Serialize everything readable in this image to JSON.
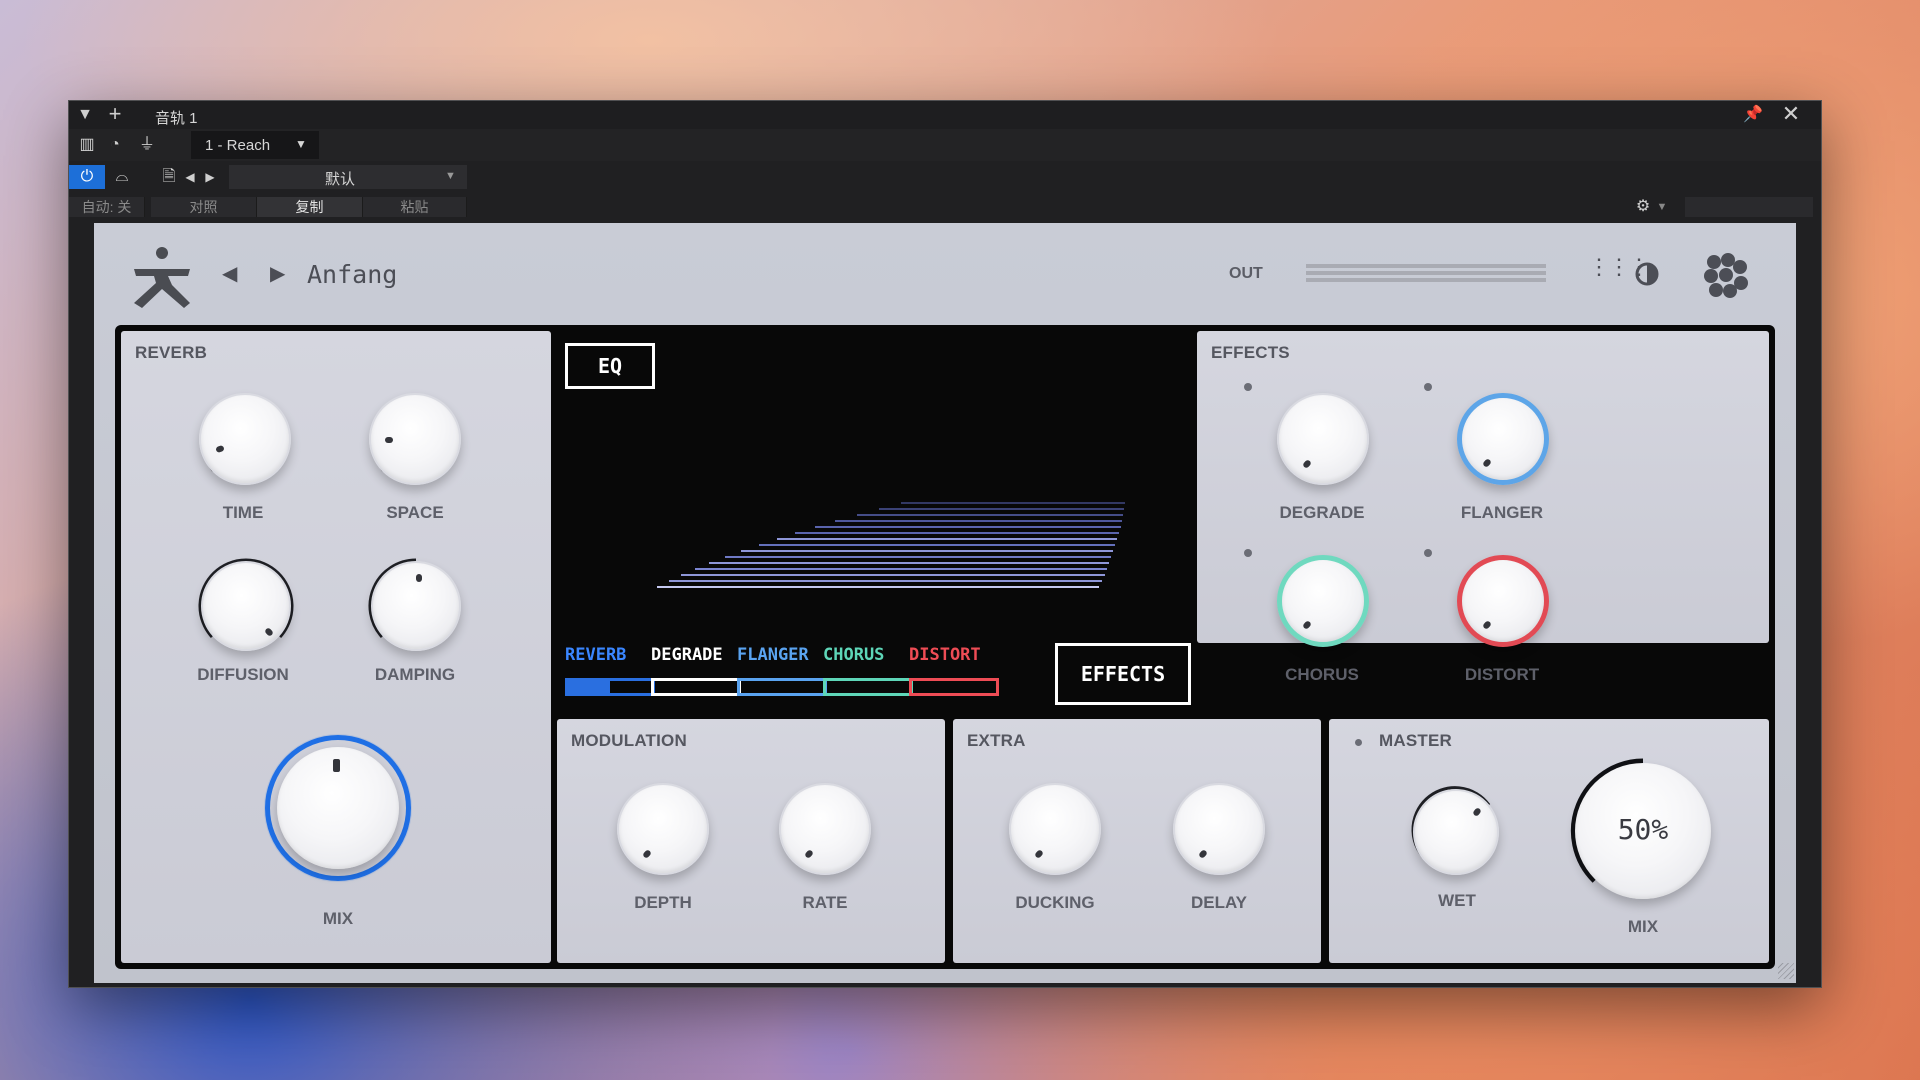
{
  "host": {
    "track_name": "音轨 1",
    "device": "1 - Reach",
    "preset_menu": "默认",
    "auto_label": "自动: 关",
    "compare_label": "对照",
    "copy_label": "复制",
    "paste_label": "粘贴"
  },
  "plugin": {
    "preset_name": "Anfang",
    "out_label": "OUT",
    "reverb": {
      "title": "REVERB",
      "knobs": [
        {
          "label": "TIME",
          "value": 0.05
        },
        {
          "label": "SPACE",
          "value": 0.02
        },
        {
          "label": "DIFFUSION",
          "value": 0.95
        },
        {
          "label": "DAMPING",
          "value": 0.5
        }
      ],
      "mix": {
        "label": "MIX",
        "value": 1.0,
        "accent": "#1f6fe5"
      }
    },
    "display": {
      "eq_button": "EQ",
      "effects_button": "EFFECTS",
      "tabs": [
        {
          "label": "REVERB",
          "color": "#3a86ff",
          "fill": 0.5
        },
        {
          "label": "DEGRADE",
          "color": "#ffffff",
          "fill": 0
        },
        {
          "label": "FLANGER",
          "color": "#5aa3f0",
          "fill": 0
        },
        {
          "label": "CHORUS",
          "color": "#5ed6b8",
          "fill": 0
        },
        {
          "label": "DISTORT",
          "color": "#ee4c55",
          "fill": 0
        }
      ]
    },
    "effects": {
      "title": "EFFECTS",
      "knobs": [
        {
          "label": "DEGRADE",
          "color": "#d6d7de",
          "value": 0.12
        },
        {
          "label": "FLANGER",
          "color": "#5da5e8",
          "value": 0.12
        },
        {
          "label": "CHORUS",
          "color": "#6fd9bf",
          "value": 0.12
        },
        {
          "label": "DISTORT",
          "color": "#e24a54",
          "value": 0.12
        }
      ]
    },
    "modulation": {
      "title": "MODULATION",
      "knobs": [
        {
          "label": "DEPTH",
          "value": 0.12
        },
        {
          "label": "RATE",
          "value": 0.12
        }
      ]
    },
    "extra": {
      "title": "EXTRA",
      "knobs": [
        {
          "label": "DUCKING",
          "value": 0.12
        },
        {
          "label": "DELAY",
          "value": 0.12
        }
      ]
    },
    "master": {
      "title": "MASTER",
      "wet": {
        "label": "WET",
        "value": 0.85
      },
      "mix": {
        "label": "MIX",
        "value": "50%",
        "fraction": 0.5
      }
    }
  },
  "colors": {
    "host_bg": "#202022",
    "accent_blue": "#1f6fe5",
    "frame": "#080808"
  }
}
